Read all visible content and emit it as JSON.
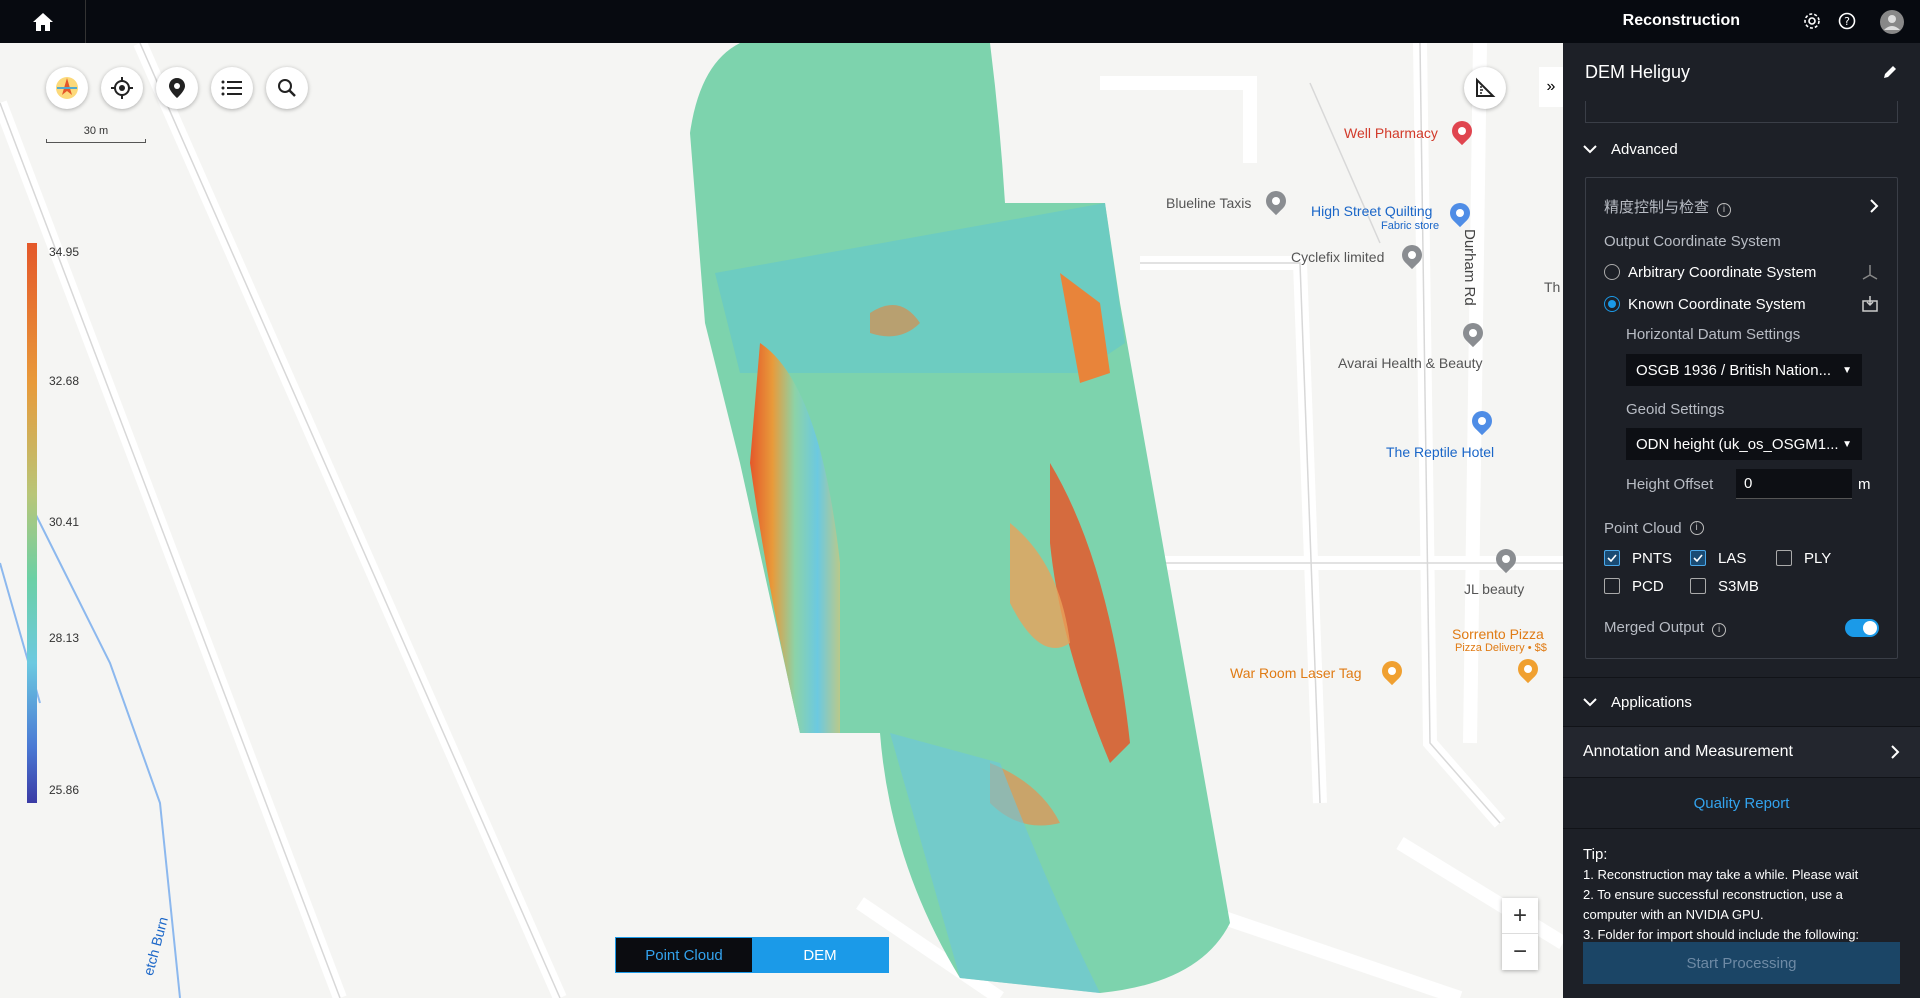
{
  "topbar": {
    "title": "Reconstruction"
  },
  "map": {
    "scale_label": "30 m",
    "legend": [
      "34.95",
      "32.68",
      "30.41",
      "28.13",
      "25.86"
    ],
    "places": [
      {
        "name": "Well Pharmacy",
        "tone": "red"
      },
      {
        "name": "Blueline Taxis",
        "tone": "gray"
      },
      {
        "name": "High Street Quilting",
        "tone": "blue"
      },
      {
        "name": "Fabric store",
        "tone": "blue"
      },
      {
        "name": "Cyclefix limited",
        "tone": "gray"
      },
      {
        "name": "Avarai Health & Beauty",
        "tone": "gray"
      },
      {
        "name": "The Reptile Hotel",
        "tone": "blue"
      },
      {
        "name": "JL beauty",
        "tone": "gray"
      },
      {
        "name": "Sorrento Pizza",
        "tone": "orange"
      },
      {
        "name": "Pizza Delivery • $$",
        "tone": "orange"
      },
      {
        "name": "War Room Laser Tag",
        "tone": "orange"
      },
      {
        "name": "Durham Rd",
        "tone": "gray"
      },
      {
        "name": "etch Burn",
        "tone": "blue"
      },
      {
        "name": "Th",
        "tone": "gray"
      }
    ],
    "view_toggle": {
      "point_cloud": "Point Cloud",
      "dem": "DEM"
    }
  },
  "panel": {
    "title": "DEM Heliguy",
    "advanced_label": "Advanced",
    "precision_label": "精度控制与检查",
    "output_cs_label": "Output Coordinate System",
    "arbitrary_cs": "Arbitrary Coordinate System",
    "known_cs": "Known Coordinate System",
    "horizontal_label": "Horizontal Datum Settings",
    "horizontal_value": "OSGB 1936 / British Nation...",
    "geoid_label": "Geoid Settings",
    "geoid_value": "ODN height (uk_os_OSGM1...",
    "height_offset_label": "Height Offset",
    "height_offset_value": "0",
    "height_unit": "m",
    "point_cloud_label": "Point Cloud",
    "formats": [
      {
        "name": "PNTS",
        "checked": true
      },
      {
        "name": "LAS",
        "checked": true
      },
      {
        "name": "PLY",
        "checked": false
      },
      {
        "name": "PCD",
        "checked": false
      },
      {
        "name": "S3MB",
        "checked": false
      }
    ],
    "merged_output_label": "Merged Output",
    "merged_output_on": true,
    "applications_label": "Applications",
    "annotation_label": "Annotation and Measurement",
    "quality_report": "Quality Report",
    "tip_title": "Tip:",
    "tips": [
      "1. Reconstruction may take a while. Please wait",
      "2. To ensure successful reconstruction, use a computer with an NVIDIA GPU.",
      "3. Folder for import should include the following:"
    ],
    "start_button": "Start Processing"
  }
}
